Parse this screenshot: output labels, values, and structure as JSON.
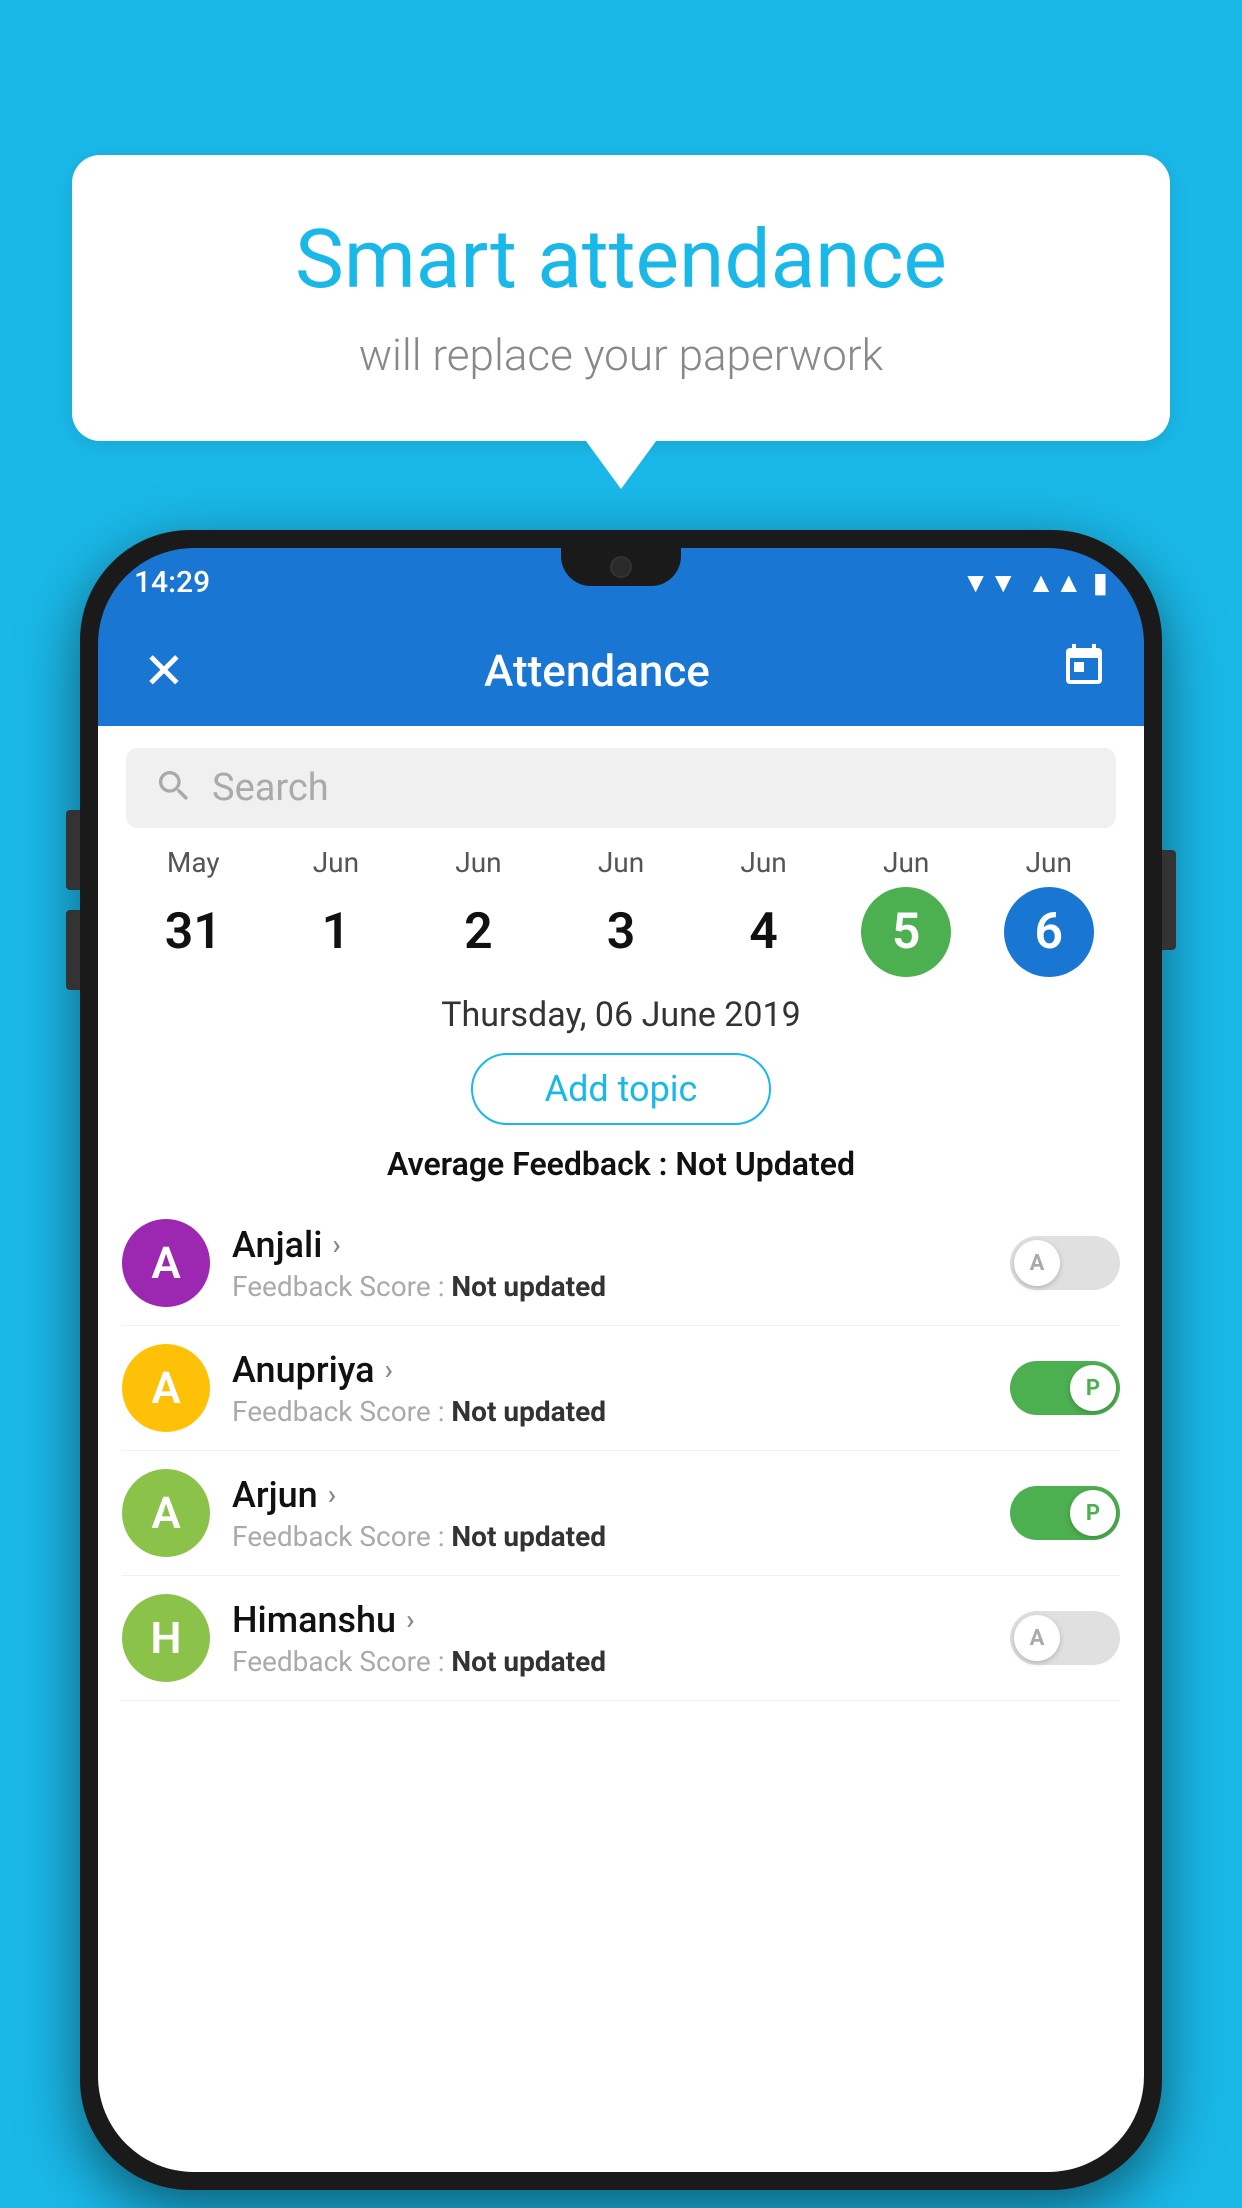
{
  "background_color": "#1ab8e8",
  "speech_bubble": {
    "title": "Smart attendance",
    "subtitle": "will replace your paperwork"
  },
  "status_bar": {
    "time": "14:29",
    "wifi": "▲",
    "signal": "▲",
    "battery": "▮"
  },
  "app_bar": {
    "close_label": "✕",
    "title": "Attendance",
    "calendar_icon": "📅"
  },
  "search": {
    "placeholder": "Search"
  },
  "calendar": {
    "days": [
      {
        "month": "May",
        "date": "31",
        "state": "normal"
      },
      {
        "month": "Jun",
        "date": "1",
        "state": "normal"
      },
      {
        "month": "Jun",
        "date": "2",
        "state": "normal"
      },
      {
        "month": "Jun",
        "date": "3",
        "state": "normal"
      },
      {
        "month": "Jun",
        "date": "4",
        "state": "normal"
      },
      {
        "month": "Jun",
        "date": "5",
        "state": "today"
      },
      {
        "month": "Jun",
        "date": "6",
        "state": "selected"
      }
    ]
  },
  "selected_date": "Thursday, 06 June 2019",
  "add_topic_label": "Add topic",
  "average_feedback": {
    "label": "Average Feedback : ",
    "value": "Not Updated"
  },
  "students": [
    {
      "name": "Anjali",
      "avatar_letter": "A",
      "avatar_color": "#9c27b0",
      "feedback": "Feedback Score : ",
      "feedback_value": "Not updated",
      "toggle": "off",
      "toggle_label": "A"
    },
    {
      "name": "Anupriya",
      "avatar_letter": "A",
      "avatar_color": "#ffc107",
      "feedback": "Feedback Score : ",
      "feedback_value": "Not updated",
      "toggle": "on",
      "toggle_label": "P"
    },
    {
      "name": "Arjun",
      "avatar_letter": "A",
      "avatar_color": "#8bc34a",
      "feedback": "Feedback Score : ",
      "feedback_value": "Not updated",
      "toggle": "on",
      "toggle_label": "P"
    },
    {
      "name": "Himanshu",
      "avatar_letter": "H",
      "avatar_color": "#8bc34a",
      "feedback": "Feedback Score : ",
      "feedback_value": "Not updated",
      "toggle": "off",
      "toggle_label": "A"
    }
  ]
}
